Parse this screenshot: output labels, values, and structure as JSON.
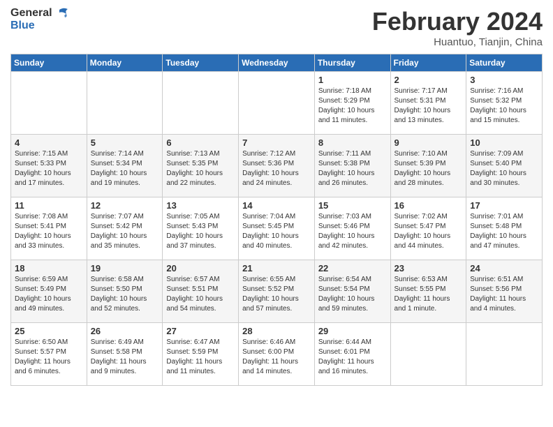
{
  "logo": {
    "general": "General",
    "blue": "Blue"
  },
  "title": "February 2024",
  "location": "Huantuo, Tianjin, China",
  "days_of_week": [
    "Sunday",
    "Monday",
    "Tuesday",
    "Wednesday",
    "Thursday",
    "Friday",
    "Saturday"
  ],
  "weeks": [
    [
      {
        "day": "",
        "info": ""
      },
      {
        "day": "",
        "info": ""
      },
      {
        "day": "",
        "info": ""
      },
      {
        "day": "",
        "info": ""
      },
      {
        "day": "1",
        "info": "Sunrise: 7:18 AM\nSunset: 5:29 PM\nDaylight: 10 hours\nand 11 minutes."
      },
      {
        "day": "2",
        "info": "Sunrise: 7:17 AM\nSunset: 5:31 PM\nDaylight: 10 hours\nand 13 minutes."
      },
      {
        "day": "3",
        "info": "Sunrise: 7:16 AM\nSunset: 5:32 PM\nDaylight: 10 hours\nand 15 minutes."
      }
    ],
    [
      {
        "day": "4",
        "info": "Sunrise: 7:15 AM\nSunset: 5:33 PM\nDaylight: 10 hours\nand 17 minutes."
      },
      {
        "day": "5",
        "info": "Sunrise: 7:14 AM\nSunset: 5:34 PM\nDaylight: 10 hours\nand 19 minutes."
      },
      {
        "day": "6",
        "info": "Sunrise: 7:13 AM\nSunset: 5:35 PM\nDaylight: 10 hours\nand 22 minutes."
      },
      {
        "day": "7",
        "info": "Sunrise: 7:12 AM\nSunset: 5:36 PM\nDaylight: 10 hours\nand 24 minutes."
      },
      {
        "day": "8",
        "info": "Sunrise: 7:11 AM\nSunset: 5:38 PM\nDaylight: 10 hours\nand 26 minutes."
      },
      {
        "day": "9",
        "info": "Sunrise: 7:10 AM\nSunset: 5:39 PM\nDaylight: 10 hours\nand 28 minutes."
      },
      {
        "day": "10",
        "info": "Sunrise: 7:09 AM\nSunset: 5:40 PM\nDaylight: 10 hours\nand 30 minutes."
      }
    ],
    [
      {
        "day": "11",
        "info": "Sunrise: 7:08 AM\nSunset: 5:41 PM\nDaylight: 10 hours\nand 33 minutes."
      },
      {
        "day": "12",
        "info": "Sunrise: 7:07 AM\nSunset: 5:42 PM\nDaylight: 10 hours\nand 35 minutes."
      },
      {
        "day": "13",
        "info": "Sunrise: 7:05 AM\nSunset: 5:43 PM\nDaylight: 10 hours\nand 37 minutes."
      },
      {
        "day": "14",
        "info": "Sunrise: 7:04 AM\nSunset: 5:45 PM\nDaylight: 10 hours\nand 40 minutes."
      },
      {
        "day": "15",
        "info": "Sunrise: 7:03 AM\nSunset: 5:46 PM\nDaylight: 10 hours\nand 42 minutes."
      },
      {
        "day": "16",
        "info": "Sunrise: 7:02 AM\nSunset: 5:47 PM\nDaylight: 10 hours\nand 44 minutes."
      },
      {
        "day": "17",
        "info": "Sunrise: 7:01 AM\nSunset: 5:48 PM\nDaylight: 10 hours\nand 47 minutes."
      }
    ],
    [
      {
        "day": "18",
        "info": "Sunrise: 6:59 AM\nSunset: 5:49 PM\nDaylight: 10 hours\nand 49 minutes."
      },
      {
        "day": "19",
        "info": "Sunrise: 6:58 AM\nSunset: 5:50 PM\nDaylight: 10 hours\nand 52 minutes."
      },
      {
        "day": "20",
        "info": "Sunrise: 6:57 AM\nSunset: 5:51 PM\nDaylight: 10 hours\nand 54 minutes."
      },
      {
        "day": "21",
        "info": "Sunrise: 6:55 AM\nSunset: 5:52 PM\nDaylight: 10 hours\nand 57 minutes."
      },
      {
        "day": "22",
        "info": "Sunrise: 6:54 AM\nSunset: 5:54 PM\nDaylight: 10 hours\nand 59 minutes."
      },
      {
        "day": "23",
        "info": "Sunrise: 6:53 AM\nSunset: 5:55 PM\nDaylight: 11 hours\nand 1 minute."
      },
      {
        "day": "24",
        "info": "Sunrise: 6:51 AM\nSunset: 5:56 PM\nDaylight: 11 hours\nand 4 minutes."
      }
    ],
    [
      {
        "day": "25",
        "info": "Sunrise: 6:50 AM\nSunset: 5:57 PM\nDaylight: 11 hours\nand 6 minutes."
      },
      {
        "day": "26",
        "info": "Sunrise: 6:49 AM\nSunset: 5:58 PM\nDaylight: 11 hours\nand 9 minutes."
      },
      {
        "day": "27",
        "info": "Sunrise: 6:47 AM\nSunset: 5:59 PM\nDaylight: 11 hours\nand 11 minutes."
      },
      {
        "day": "28",
        "info": "Sunrise: 6:46 AM\nSunset: 6:00 PM\nDaylight: 11 hours\nand 14 minutes."
      },
      {
        "day": "29",
        "info": "Sunrise: 6:44 AM\nSunset: 6:01 PM\nDaylight: 11 hours\nand 16 minutes."
      },
      {
        "day": "",
        "info": ""
      },
      {
        "day": "",
        "info": ""
      }
    ]
  ]
}
